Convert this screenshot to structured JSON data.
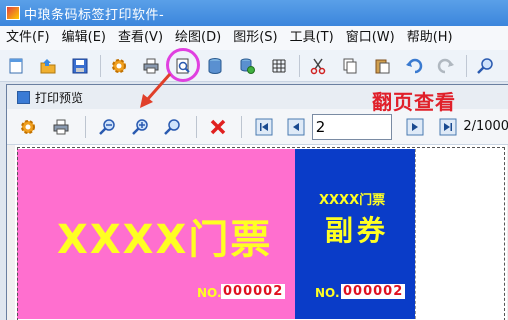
{
  "app": {
    "title": "中琅条码标签打印软件-"
  },
  "menu": [
    "文件(F)",
    "编辑(E)",
    "查看(V)",
    "绘图(D)",
    "图形(S)",
    "工具(T)",
    "窗口(W)",
    "帮助(H)"
  ],
  "main_toolbar_icons": [
    "new-file-icon",
    "open-folder-icon",
    "save-icon",
    "settings-gear-icon",
    "print-icon",
    "print-preview-icon",
    "database-icon",
    "database-settings-icon",
    "grid-icon",
    "cut-icon",
    "copy-icon",
    "paste-icon",
    "undo-icon",
    "redo-icon",
    "zoom-icon"
  ],
  "preview": {
    "title": "打印预览",
    "annotation": "翻页查看",
    "page_input_value": "2",
    "page_total": "2/1000"
  },
  "ticket": {
    "main_title": "XXXX门票",
    "no_label_main": "NO.",
    "no_value_main": "000002",
    "stub_top": "XXXX门票",
    "stub_title": "副券",
    "no_label_stub": "NO.",
    "no_value_stub": "000002"
  },
  "colors": {
    "ticket_main_bg": "#ff6fcf",
    "ticket_stub_bg": "#0a3cc8",
    "ticket_text": "#ffff22",
    "number_text": "#e01020",
    "annotation": "#e0202a",
    "highlight_circle": "#e040e0"
  }
}
